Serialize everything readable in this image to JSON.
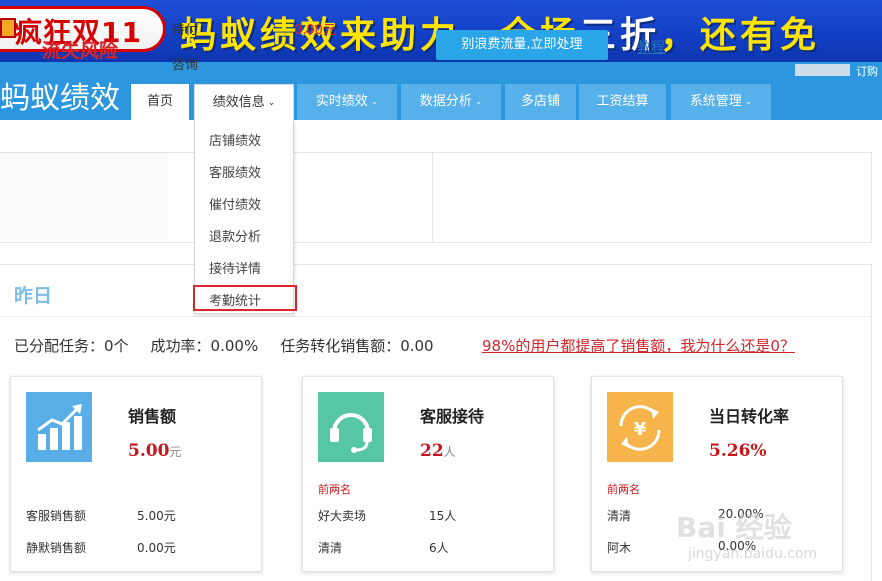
{
  "banner": {
    "left_text": "疯狂双11",
    "main_text_a": "蚂蚁绩效来助力，全场",
    "main_text_b": "三折",
    "main_text_c": "，还有免"
  },
  "header": {
    "brand": "蚂蚁绩效",
    "subscribe": "订购"
  },
  "nav": {
    "items": [
      {
        "label": "首页"
      },
      {
        "label": "绩效信息"
      },
      {
        "label": "实时绩效"
      },
      {
        "label": "数据分析"
      },
      {
        "label": "多店铺"
      },
      {
        "label": "工资结算"
      },
      {
        "label": "系统管理"
      }
    ],
    "caret": "⌄"
  },
  "dropdown": {
    "items": [
      {
        "label": "店铺绩效"
      },
      {
        "label": "客服绩效"
      },
      {
        "label": "催付绩效"
      },
      {
        "label": "退款分析"
      },
      {
        "label": "接待详情"
      },
      {
        "label": "考勤统计"
      }
    ]
  },
  "loss": {
    "title": "流失风险",
    "row1_label": "待付",
    "row1_amount": "0.00元",
    "row2_label": "咨询",
    "button": "别浪费流量,立即处理",
    "tutorial": "教程"
  },
  "yesterday": {
    "title": "昨日",
    "assigned": "已分配任务：0个",
    "success_rate": "成功率：0.00%",
    "conversion_sales": "任务转化销售额：0.00",
    "promo_link": "98%的用户都提高了销售额，我为什么还是0？"
  },
  "cards": [
    {
      "label": "销售额",
      "value": "5.00",
      "unit": "元",
      "icon": "chart-growth-icon",
      "color": "#5aaee8",
      "rank_label": "",
      "rows": [
        {
          "label": "客服销售额",
          "value": "5.00元"
        },
        {
          "label": "静默销售额",
          "value": "0.00元"
        }
      ]
    },
    {
      "label": "客服接待",
      "value": "22",
      "unit": "人",
      "icon": "headset-icon",
      "color": "#56c6a4",
      "rank_label": "前两名",
      "rows": [
        {
          "label": "好大卖场",
          "value": "15人"
        },
        {
          "label": "清清",
          "value": "6人"
        }
      ]
    },
    {
      "label": "当日转化率",
      "value": "5.26%",
      "unit": "",
      "icon": "yuan-exchange-icon",
      "color": "#f6b44a",
      "rank_label": "前两名",
      "rows": [
        {
          "label": "清清",
          "value": "20.00%"
        },
        {
          "label": "阿木",
          "value": "0.00%"
        }
      ]
    }
  ],
  "watermark": {
    "line1": "Bai 经验",
    "line2": "jingyan.baidu.com"
  }
}
